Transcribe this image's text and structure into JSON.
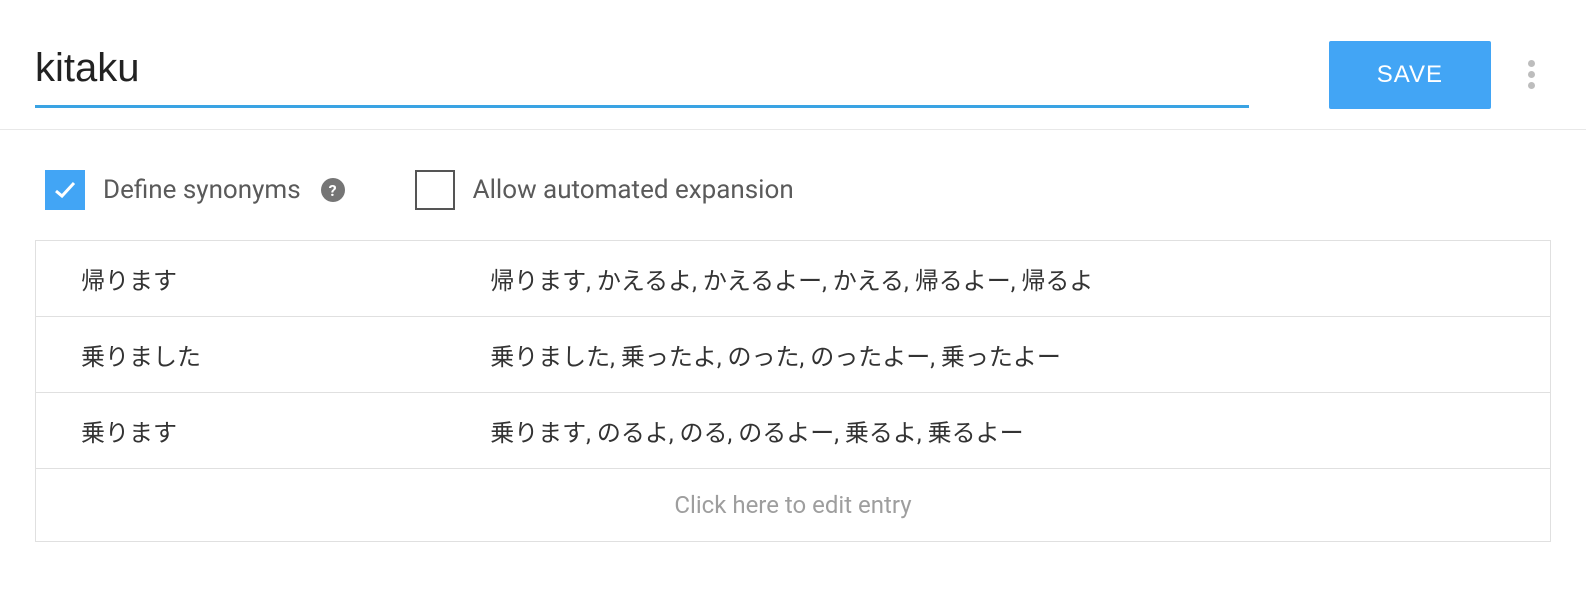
{
  "header": {
    "entity_name": "kitaku",
    "save_label": "SAVE"
  },
  "options": {
    "define_synonyms": {
      "label": "Define synonyms",
      "checked": true
    },
    "allow_automated_expansion": {
      "label": "Allow automated expansion",
      "checked": false
    }
  },
  "entries": [
    {
      "reference": "帰ります",
      "synonyms": "帰ります, かえるよ, かえるよー, かえる, 帰るよー, 帰るよ"
    },
    {
      "reference": "乗りました",
      "synonyms": "乗りました, 乗ったよ, のった, のったよー, 乗ったよー"
    },
    {
      "reference": "乗ります",
      "synonyms": "乗ります, のるよ, のる, のるよー, 乗るよ, 乗るよー"
    }
  ],
  "add_row_text": "Click here to edit entry"
}
